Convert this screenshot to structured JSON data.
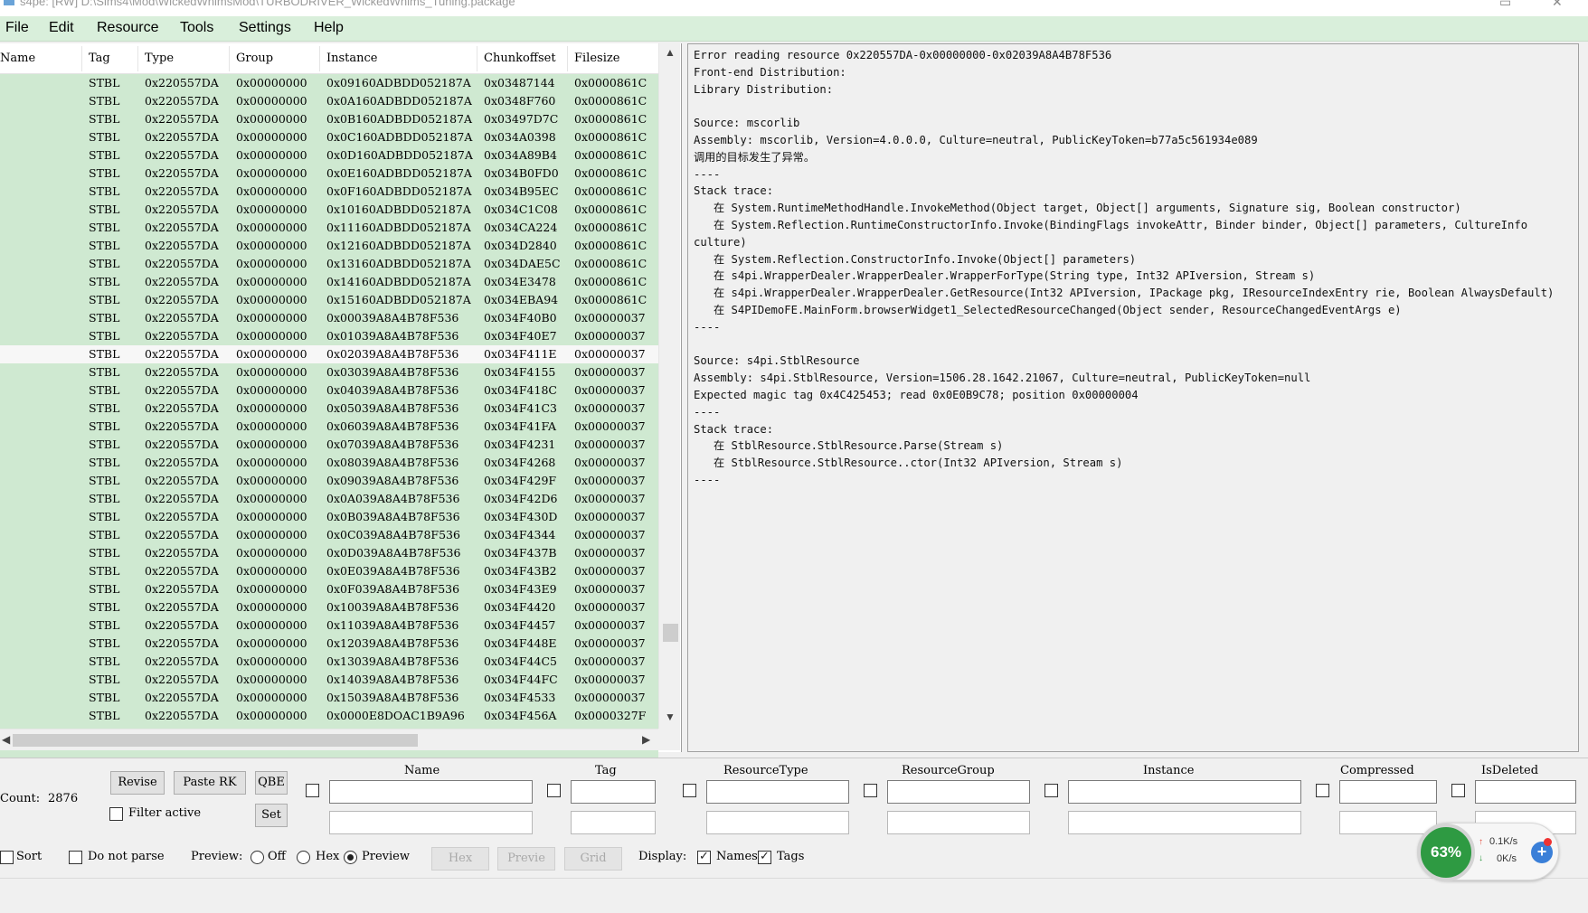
{
  "window": {
    "title": "s4pe: [RW] D:\\Sims4\\Mod\\WickedWhimsMod\\TURBODRIVER_WickedWhims_Tuning.package"
  },
  "menu": [
    "File",
    "Edit",
    "Resource",
    "Tools",
    "Settings",
    "Help"
  ],
  "list": {
    "columns": [
      "Name",
      "Tag",
      "Type",
      "Group",
      "Instance",
      "Chunkoffset",
      "Filesize"
    ],
    "selected_index": 15,
    "rows": [
      [
        "",
        "STBL",
        "0x220557DA",
        "0x00000000",
        "0x09160ADBDD052187A",
        "0x03487144",
        "0x0000861C"
      ],
      [
        "",
        "STBL",
        "0x220557DA",
        "0x00000000",
        "0x0A160ADBDD052187A",
        "0x0348F760",
        "0x0000861C"
      ],
      [
        "",
        "STBL",
        "0x220557DA",
        "0x00000000",
        "0x0B160ADBDD052187A",
        "0x03497D7C",
        "0x0000861C"
      ],
      [
        "",
        "STBL",
        "0x220557DA",
        "0x00000000",
        "0x0C160ADBDD052187A",
        "0x034A0398",
        "0x0000861C"
      ],
      [
        "",
        "STBL",
        "0x220557DA",
        "0x00000000",
        "0x0D160ADBDD052187A",
        "0x034A89B4",
        "0x0000861C"
      ],
      [
        "",
        "STBL",
        "0x220557DA",
        "0x00000000",
        "0x0E160ADBDD052187A",
        "0x034B0FD0",
        "0x0000861C"
      ],
      [
        "",
        "STBL",
        "0x220557DA",
        "0x00000000",
        "0x0F160ADBDD052187A",
        "0x034B95EC",
        "0x0000861C"
      ],
      [
        "",
        "STBL",
        "0x220557DA",
        "0x00000000",
        "0x10160ADBDD052187A",
        "0x034C1C08",
        "0x0000861C"
      ],
      [
        "",
        "STBL",
        "0x220557DA",
        "0x00000000",
        "0x11160ADBDD052187A",
        "0x034CA224",
        "0x0000861C"
      ],
      [
        "",
        "STBL",
        "0x220557DA",
        "0x00000000",
        "0x12160ADBDD052187A",
        "0x034D2840",
        "0x0000861C"
      ],
      [
        "",
        "STBL",
        "0x220557DA",
        "0x00000000",
        "0x13160ADBDD052187A",
        "0x034DAE5C",
        "0x0000861C"
      ],
      [
        "",
        "STBL",
        "0x220557DA",
        "0x00000000",
        "0x14160ADBDD052187A",
        "0x034E3478",
        "0x0000861C"
      ],
      [
        "",
        "STBL",
        "0x220557DA",
        "0x00000000",
        "0x15160ADBDD052187A",
        "0x034EBA94",
        "0x0000861C"
      ],
      [
        "",
        "STBL",
        "0x220557DA",
        "0x00000000",
        "0x00039A8A4B78F536",
        "0x034F40B0",
        "0x00000037"
      ],
      [
        "",
        "STBL",
        "0x220557DA",
        "0x00000000",
        "0x01039A8A4B78F536",
        "0x034F40E7",
        "0x00000037"
      ],
      [
        "",
        "STBL",
        "0x220557DA",
        "0x00000000",
        "0x02039A8A4B78F536",
        "0x034F411E",
        "0x00000037"
      ],
      [
        "",
        "STBL",
        "0x220557DA",
        "0x00000000",
        "0x03039A8A4B78F536",
        "0x034F4155",
        "0x00000037"
      ],
      [
        "",
        "STBL",
        "0x220557DA",
        "0x00000000",
        "0x04039A8A4B78F536",
        "0x034F418C",
        "0x00000037"
      ],
      [
        "",
        "STBL",
        "0x220557DA",
        "0x00000000",
        "0x05039A8A4B78F536",
        "0x034F41C3",
        "0x00000037"
      ],
      [
        "",
        "STBL",
        "0x220557DA",
        "0x00000000",
        "0x06039A8A4B78F536",
        "0x034F41FA",
        "0x00000037"
      ],
      [
        "",
        "STBL",
        "0x220557DA",
        "0x00000000",
        "0x07039A8A4B78F536",
        "0x034F4231",
        "0x00000037"
      ],
      [
        "",
        "STBL",
        "0x220557DA",
        "0x00000000",
        "0x08039A8A4B78F536",
        "0x034F4268",
        "0x00000037"
      ],
      [
        "",
        "STBL",
        "0x220557DA",
        "0x00000000",
        "0x09039A8A4B78F536",
        "0x034F429F",
        "0x00000037"
      ],
      [
        "",
        "STBL",
        "0x220557DA",
        "0x00000000",
        "0x0A039A8A4B78F536",
        "0x034F42D6",
        "0x00000037"
      ],
      [
        "",
        "STBL",
        "0x220557DA",
        "0x00000000",
        "0x0B039A8A4B78F536",
        "0x034F430D",
        "0x00000037"
      ],
      [
        "",
        "STBL",
        "0x220557DA",
        "0x00000000",
        "0x0C039A8A4B78F536",
        "0x034F4344",
        "0x00000037"
      ],
      [
        "",
        "STBL",
        "0x220557DA",
        "0x00000000",
        "0x0D039A8A4B78F536",
        "0x034F437B",
        "0x00000037"
      ],
      [
        "",
        "STBL",
        "0x220557DA",
        "0x00000000",
        "0x0E039A8A4B78F536",
        "0x034F43B2",
        "0x00000037"
      ],
      [
        "",
        "STBL",
        "0x220557DA",
        "0x00000000",
        "0x0F039A8A4B78F536",
        "0x034F43E9",
        "0x00000037"
      ],
      [
        "",
        "STBL",
        "0x220557DA",
        "0x00000000",
        "0x10039A8A4B78F536",
        "0x034F4420",
        "0x00000037"
      ],
      [
        "",
        "STBL",
        "0x220557DA",
        "0x00000000",
        "0x11039A8A4B78F536",
        "0x034F4457",
        "0x00000037"
      ],
      [
        "",
        "STBL",
        "0x220557DA",
        "0x00000000",
        "0x12039A8A4B78F536",
        "0x034F448E",
        "0x00000037"
      ],
      [
        "",
        "STBL",
        "0x220557DA",
        "0x00000000",
        "0x13039A8A4B78F536",
        "0x034F44C5",
        "0x00000037"
      ],
      [
        "",
        "STBL",
        "0x220557DA",
        "0x00000000",
        "0x14039A8A4B78F536",
        "0x034F44FC",
        "0x00000037"
      ],
      [
        "",
        "STBL",
        "0x220557DA",
        "0x00000000",
        "0x15039A8A4B78F536",
        "0x034F4533",
        "0x00000037"
      ],
      [
        "",
        "STBL",
        "0x220557DA",
        "0x00000000",
        "0x0000E8DOAC1B9A96",
        "0x034F456A",
        "0x0000327F"
      ]
    ]
  },
  "preview": {
    "lines": [
      "Error reading resource 0x220557DA-0x00000000-0x02039A8A4B78F536",
      "Front-end Distribution:",
      "Library Distribution:",
      "",
      "Source: mscorlib",
      "Assembly: mscorlib, Version=4.0.0.0, Culture=neutral, PublicKeyToken=b77a5c561934e089",
      "调用的目标发生了异常。",
      "----",
      "Stack trace:",
      "   在 System.RuntimeMethodHandle.InvokeMethod(Object target, Object[] arguments, Signature sig, Boolean constructor)",
      "   在 System.Reflection.RuntimeConstructorInfo.Invoke(BindingFlags invokeAttr, Binder binder, Object[] parameters, CultureInfo",
      "culture)",
      "   在 System.Reflection.ConstructorInfo.Invoke(Object[] parameters)",
      "   在 s4pi.WrapperDealer.WrapperDealer.WrapperForType(String type, Int32 APIversion, Stream s)",
      "   在 s4pi.WrapperDealer.WrapperDealer.GetResource(Int32 APIversion, IPackage pkg, IResourceIndexEntry rie, Boolean AlwaysDefault)",
      "   在 S4PIDemoFE.MainForm.browserWidget1_SelectedResourceChanged(Object sender, ResourceChangedEventArgs e)",
      "----",
      "",
      "Source: s4pi.StblResource",
      "Assembly: s4pi.StblResource, Version=1506.28.1642.21067, Culture=neutral, PublicKeyToken=null",
      "Expected magic tag 0x4C425453; read 0x0E0B9C78; position 0x00000004",
      "----",
      "Stack trace:",
      "   在 StblResource.StblResource.Parse(Stream s)",
      "   在 StblResource.StblResource..ctor(Int32 APIversion, Stream s)",
      "----"
    ]
  },
  "bottom": {
    "count_label": "Count:",
    "count_value": "2876",
    "revise": "Revise",
    "paste_rk": "Paste RK",
    "qbe": "QBE",
    "filter_active": "Filter active",
    "set": "Set",
    "filter_columns": [
      "Name",
      "Tag",
      "ResourceType",
      "ResourceGroup",
      "Instance",
      "Compressed",
      "IsDeleted"
    ],
    "sort": "Sort",
    "do_not_parse": "Do not parse",
    "preview_label": "Preview:",
    "preview_off": "Off",
    "preview_hex": "Hex",
    "preview_preview": "Preview",
    "btn_hex": "Hex",
    "btn_preview": "Previe",
    "btn_grid": "Grid",
    "display_label": "Display:",
    "display_names": "Names",
    "display_tags": "Tags"
  },
  "widget": {
    "percent": "63%",
    "up_speed": "0.1K/s",
    "down_speed": "0K/s"
  }
}
